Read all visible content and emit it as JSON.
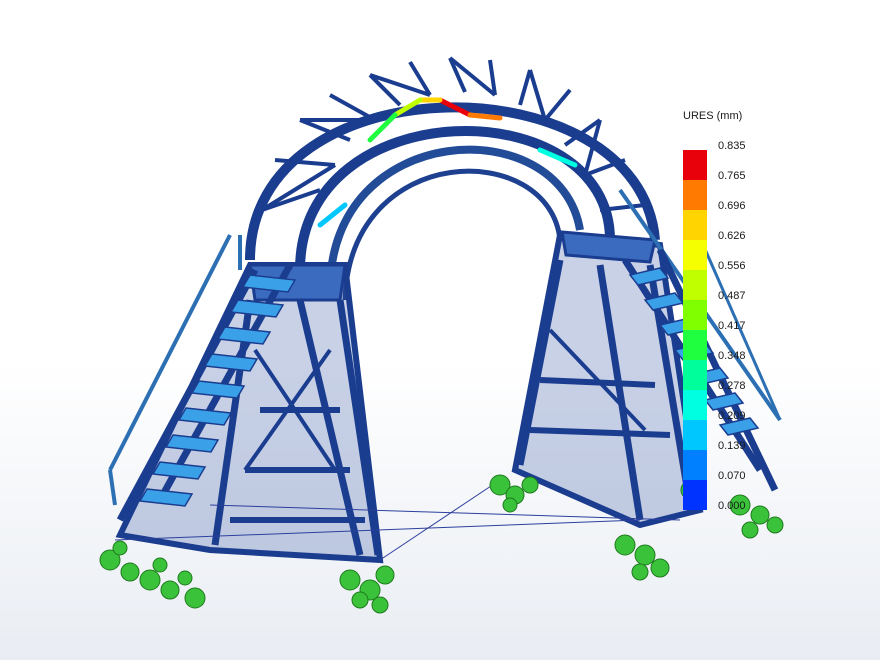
{
  "legend": {
    "title": "URES (mm)",
    "levels": [
      "0.835",
      "0.765",
      "0.696",
      "0.626",
      "0.556",
      "0.487",
      "0.417",
      "0.348",
      "0.278",
      "0.209",
      "0.139",
      "0.070",
      "0.000"
    ],
    "colors": [
      "#e8000b",
      "#ff7a00",
      "#ffd400",
      "#f5ff00",
      "#bfff00",
      "#7fff00",
      "#1fff40",
      "#00ff9a",
      "#00ffe0",
      "#00c8ff",
      "#0080ff",
      "#0033ff",
      "#0000e0"
    ]
  },
  "model": {
    "frame_color": "#1b3d8f",
    "fixture_color": "#3ac23a",
    "hotspot_color": "#e8000b"
  }
}
